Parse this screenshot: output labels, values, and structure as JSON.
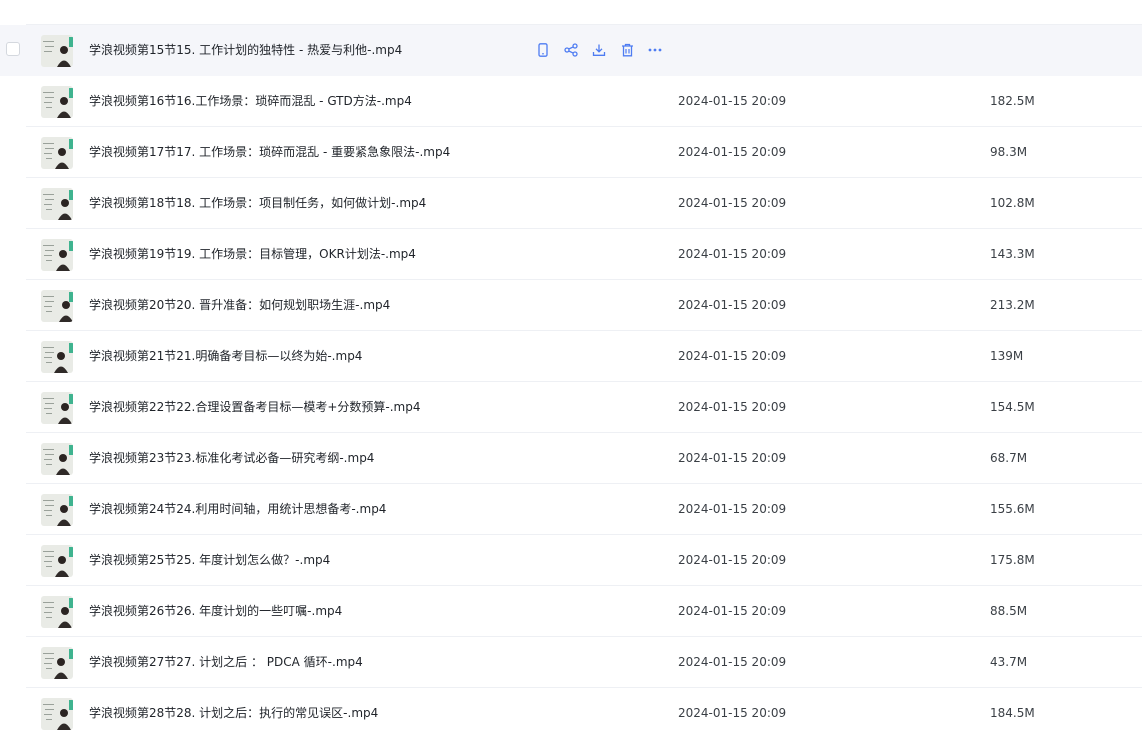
{
  "colors": {
    "accent": "#4e7cf2",
    "row_hover": "#f5f6fa",
    "separator": "#eef0f4"
  },
  "hovered_row": {
    "name": "学浪视频第15节15. 工作计划的独特性 - 热爱与利他-.mp4",
    "actions": [
      "mobile-icon",
      "share-icon",
      "download-icon",
      "delete-icon",
      "more-icon"
    ]
  },
  "files": [
    {
      "name": "学浪视频第16节16.工作场景：琐碎而混乱 - GTD方法-.mp4",
      "date": "2024-01-15 20:09",
      "size": "182.5M"
    },
    {
      "name": "学浪视频第17节17. 工作场景：琐碎而混乱 - 重要紧急象限法-.mp4",
      "date": "2024-01-15 20:09",
      "size": "98.3M"
    },
    {
      "name": "学浪视频第18节18. 工作场景：项目制任务，如何做计划-.mp4",
      "date": "2024-01-15 20:09",
      "size": "102.8M"
    },
    {
      "name": "学浪视频第19节19. 工作场景：目标管理，OKR计划法-.mp4",
      "date": "2024-01-15 20:09",
      "size": "143.3M"
    },
    {
      "name": "学浪视频第20节20. 晋升准备：如何规划职场生涯-.mp4",
      "date": "2024-01-15 20:09",
      "size": "213.2M"
    },
    {
      "name": "学浪视频第21节21.明确备考目标—以终为始-.mp4",
      "date": "2024-01-15 20:09",
      "size": "139M"
    },
    {
      "name": "学浪视频第22节22.合理设置备考目标—模考+分数预算-.mp4",
      "date": "2024-01-15 20:09",
      "size": "154.5M"
    },
    {
      "name": "学浪视频第23节23.标准化考试必备—研究考纲-.mp4",
      "date": "2024-01-15 20:09",
      "size": "68.7M"
    },
    {
      "name": "学浪视频第24节24.利用时间轴，用统计思想备考-.mp4",
      "date": "2024-01-15 20:09",
      "size": "155.6M"
    },
    {
      "name": "学浪视频第25节25. 年度计划怎么做？-.mp4",
      "date": "2024-01-15 20:09",
      "size": "175.8M"
    },
    {
      "name": "学浪视频第26节26. 年度计划的一些叮嘱-.mp4",
      "date": "2024-01-15 20:09",
      "size": "88.5M"
    },
    {
      "name": "学浪视频第27节27. 计划之后 ： PDCA 循环-.mp4",
      "date": "2024-01-15 20:09",
      "size": "43.7M"
    },
    {
      "name": "学浪视频第28节28. 计划之后：执行的常见误区-.mp4",
      "date": "2024-01-15 20:09",
      "size": "184.5M"
    }
  ]
}
